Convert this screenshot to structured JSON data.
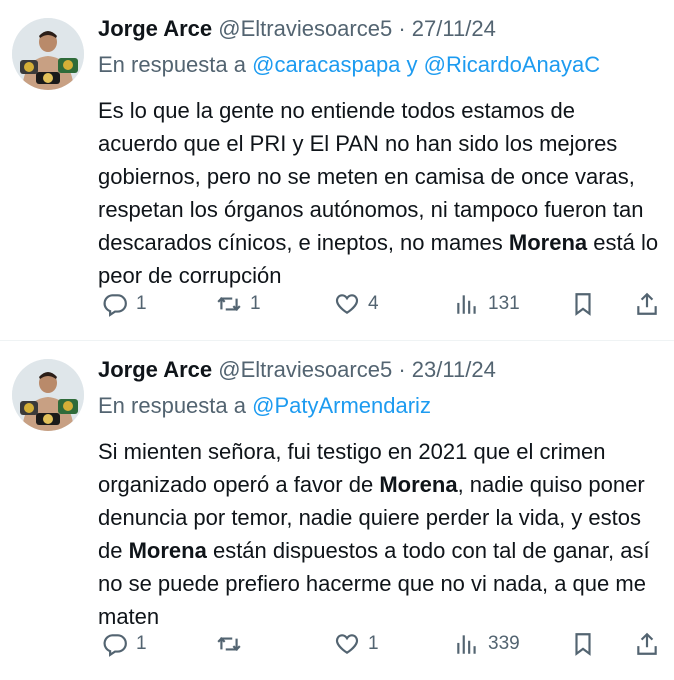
{
  "tweets": [
    {
      "author_name": "Jorge Arce",
      "handle": "@Eltraviesoarce5",
      "separator": "·",
      "date": "27/11/24",
      "reply_prefix": "En respuesta a",
      "mentions": [
        "@caracaspapa",
        "@RicardoAnayaC"
      ],
      "mention_joiner": "y",
      "body_before": "Es lo que la gente no entiende todos estamos de acuerdo que el PRI y El PAN no han sido los mejores gobiernos, pero no se meten en camisa de once varas, respetan los órganos autónomos, ni tampoco fueron tan descarados cínicos, e ineptos, no mames ",
      "body_bold": "Morena",
      "body_after": " está lo peor de corrupción",
      "reply_count": "1",
      "retweet_count": "1",
      "like_count": "4",
      "view_count": "131"
    },
    {
      "author_name": "Jorge Arce",
      "handle": "@Eltraviesoarce5",
      "separator": "·",
      "date": "23/11/24",
      "reply_prefix": "En respuesta a",
      "mentions": [
        "@PatyArmendariz"
      ],
      "body_part1": "Si mienten señora, fui testigo en 2021 que el crimen organizado operó a favor de ",
      "body_bold1": "Morena",
      "body_part2": ", nadie quiso poner denuncia por temor, nadie quiere perder la vida, y estos de ",
      "body_bold2": "Morena",
      "body_part3": " están dispuestos a todo con tal de ganar, así no se puede prefiero hacerme que no vi nada, a que me maten",
      "reply_count": "1",
      "retweet_count": "",
      "like_count": "1",
      "view_count": "339"
    }
  ],
  "icons": {
    "reply": "reply-icon",
    "retweet": "retweet-icon",
    "like": "heart-icon",
    "views": "views-icon",
    "bookmark": "bookmark-icon",
    "share": "share-icon"
  },
  "colors": {
    "text": "#0f1419",
    "secondary": "#536471",
    "link": "#1d9bf0",
    "divider": "#eff3f4"
  }
}
